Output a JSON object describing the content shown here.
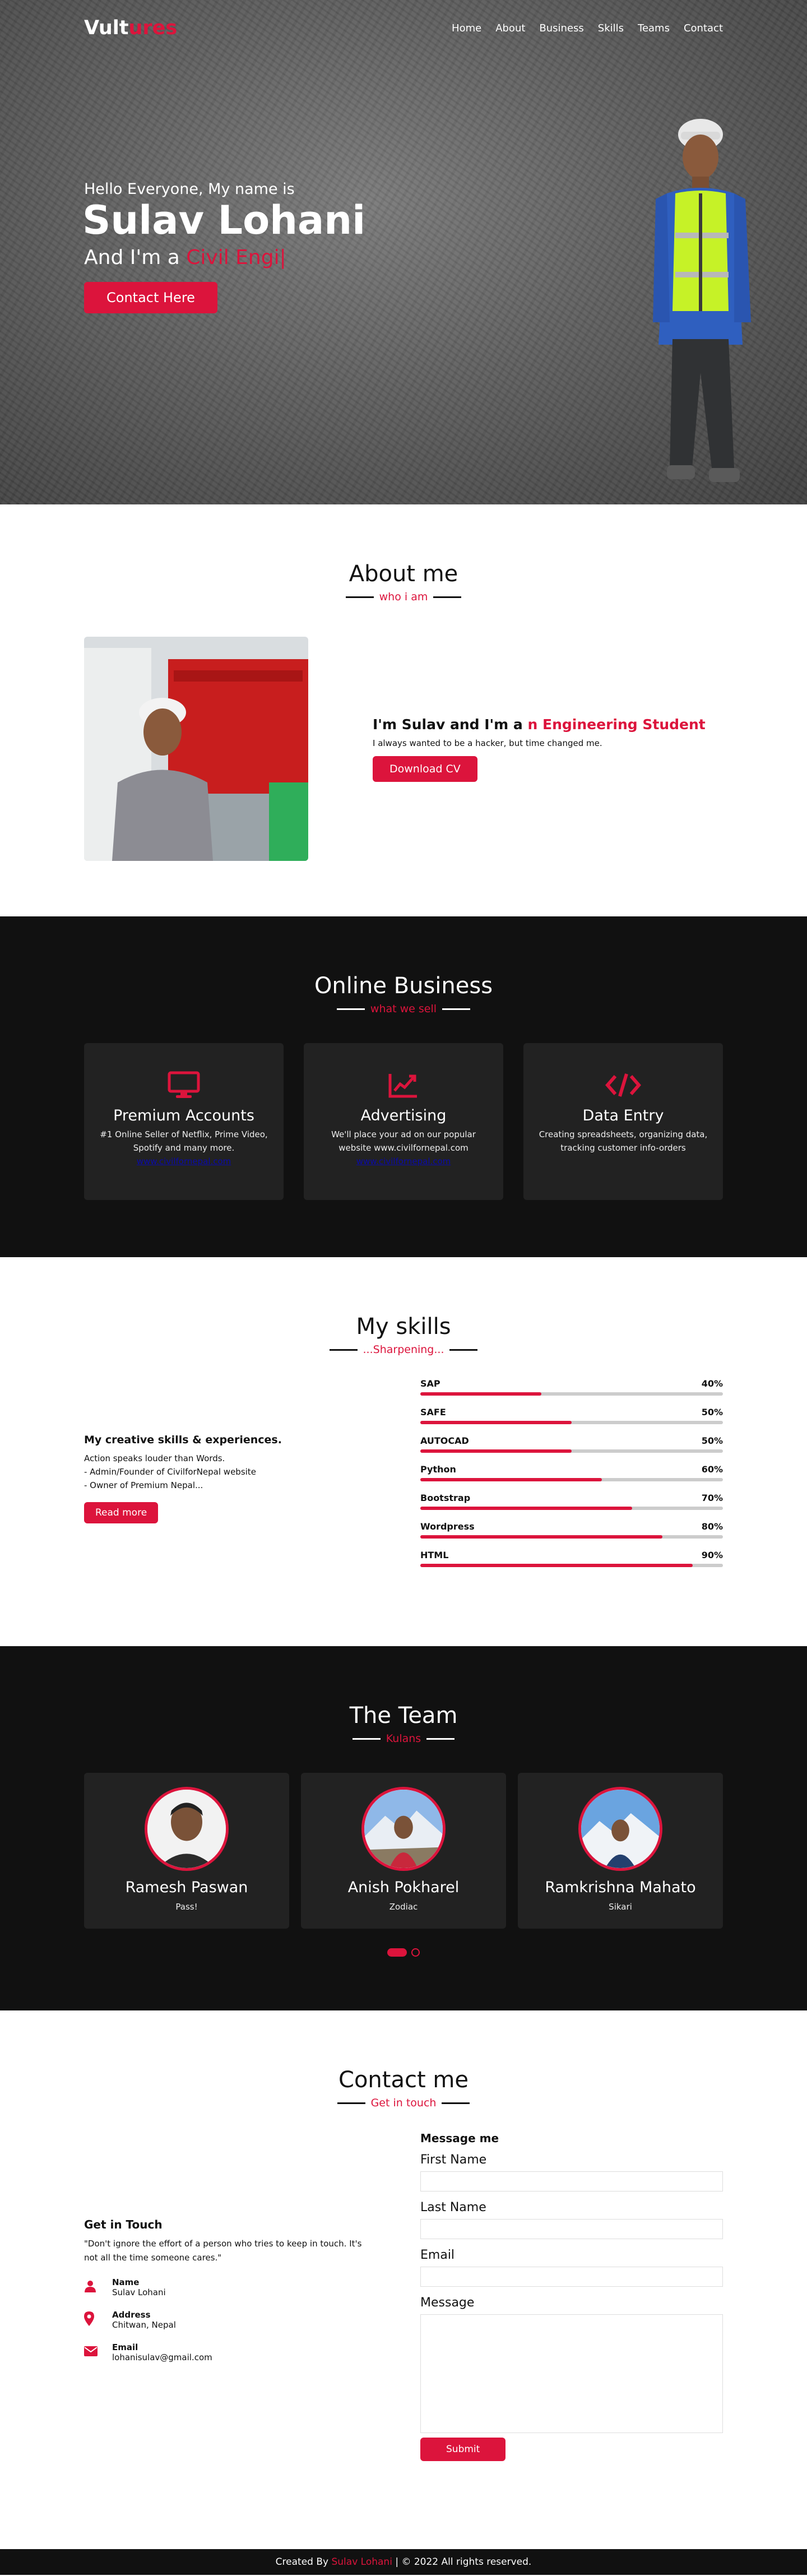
{
  "nav": {
    "logo_main": "Vult",
    "logo_accent": "ures",
    "items": [
      "Home",
      "About",
      "Business",
      "Skills",
      "Teams",
      "Contact"
    ]
  },
  "home": {
    "greeting": "Hello Everyone, My name is",
    "name": "Sulav Lohani",
    "role_prefix": "And I'm a",
    "role_typed": "Civil Engi|",
    "button": "Contact Here"
  },
  "about": {
    "title": "About me",
    "subtitle": "who i am",
    "heading_prefix": "I'm Sulav and I'm a",
    "heading_accent": "n Engineering Student",
    "description": "I always wanted to be a hacker, but time changed me.",
    "button": "Download CV"
  },
  "services": {
    "title": "Online Business",
    "subtitle": "what we sell",
    "cards": [
      {
        "icon": "desktop-icon",
        "title": "Premium Accounts",
        "desc": "#1 Online Seller of Netflix, Prime Video, Spotify and many more.",
        "link": "www.civilfornepal.com"
      },
      {
        "icon": "chart-line-icon",
        "title": "Advertising",
        "desc": "We'll place your ad on our popular website www.civilfornepal.com",
        "link": "www.civilfornepal.com"
      },
      {
        "icon": "code-icon",
        "title": "Data Entry",
        "desc": "Creating spreadsheets, organizing data, tracking customer info-orders",
        "link": ""
      }
    ]
  },
  "skills": {
    "title": "My skills",
    "subtitle": "...Sharpening...",
    "left_title": "My creative skills & experiences.",
    "lines": [
      "Action speaks louder than Words.",
      "- Admin/Founder of CivilforNepal website",
      "- Owner of Premium Nepal..."
    ],
    "button": "Read more",
    "items": [
      {
        "name": "SAP",
        "percent": "40%",
        "value": 0.4
      },
      {
        "name": "SAFE",
        "percent": "50%",
        "value": 0.5
      },
      {
        "name": "AUTOCAD",
        "percent": "50%",
        "value": 0.5
      },
      {
        "name": "Python",
        "percent": "60%",
        "value": 0.6
      },
      {
        "name": "Bootstrap",
        "percent": "70%",
        "value": 0.7
      },
      {
        "name": "Wordpress",
        "percent": "80%",
        "value": 0.8
      },
      {
        "name": "HTML",
        "percent": "90%",
        "value": 0.9
      }
    ]
  },
  "teams": {
    "title": "The Team",
    "subtitle": "Kulans",
    "members": [
      {
        "name": "Ramesh Paswan",
        "role": "Pass!"
      },
      {
        "name": "Anish Pokharel",
        "role": "Zodiac"
      },
      {
        "name": "Ramkrishna Mahato",
        "role": "Sikari"
      }
    ],
    "active_slide": 1,
    "slide_count": 2
  },
  "contact": {
    "title": "Contact me",
    "subtitle": "Get in touch",
    "left_title": "Get in Touch",
    "quote": "\"Don't ignore the effort of a person who tries to keep in touch. It's not all the time someone cares.\"",
    "rows": [
      {
        "icon": "user-icon",
        "head": "Name",
        "value": "Sulav Lohani"
      },
      {
        "icon": "map-marker-icon",
        "head": "Address",
        "value": "Chitwan, Nepal"
      },
      {
        "icon": "envelope-icon",
        "head": "Email",
        "value": "lohanisulav@gmail.com"
      }
    ],
    "form_title": "Message me",
    "labels": {
      "first": "First Name",
      "last": "Last Name",
      "email": "Email",
      "message": "Message"
    },
    "submit": "Submit"
  },
  "footer": {
    "prefix": "Created By",
    "credit": "Sulav Lohani",
    "suffix": "| © 2022 All rights reserved."
  },
  "colors": {
    "accent": "#dc143c",
    "dark": "#111111",
    "card": "#222222"
  }
}
